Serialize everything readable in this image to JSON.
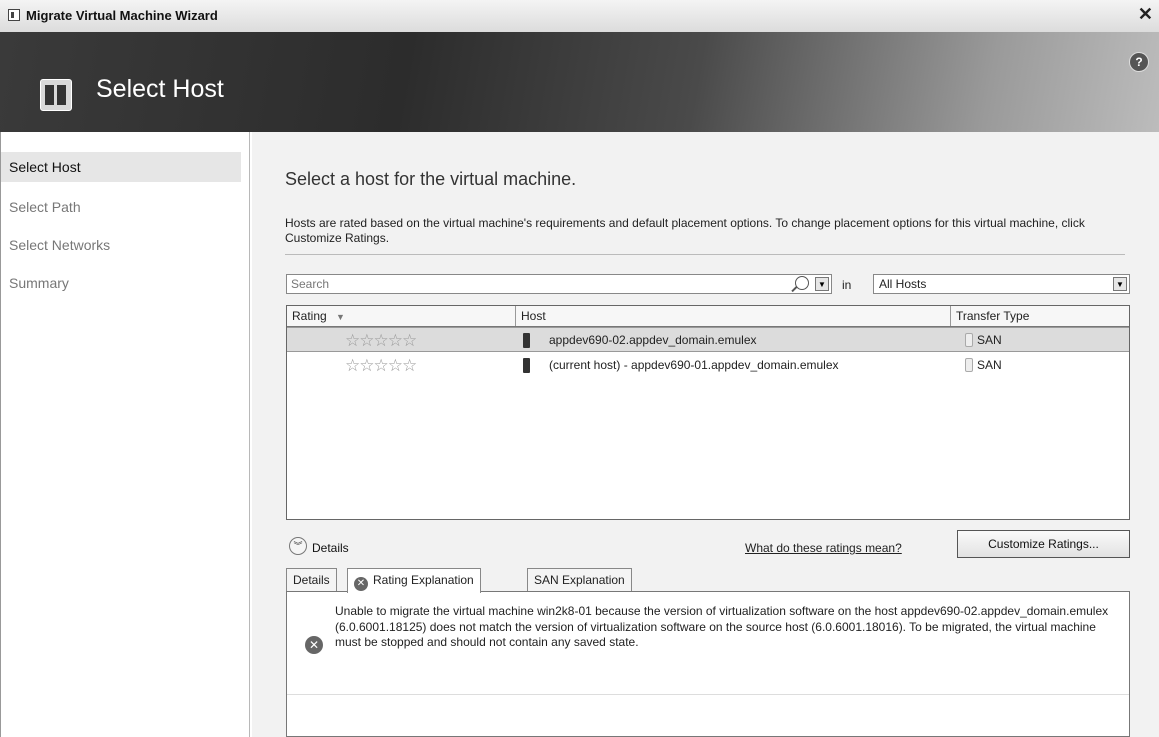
{
  "window": {
    "title": "Migrate Virtual Machine Wizard",
    "close_glyph": "✕"
  },
  "banner": {
    "title": "Select Host",
    "help_glyph": "?"
  },
  "nav": {
    "items": [
      "Select Host",
      "Select Path",
      "Select Networks",
      "Summary"
    ],
    "active": 0
  },
  "main": {
    "heading": "Select a host for the virtual machine.",
    "description": "Hosts are rated based on the virtual machine's requirements and default placement options. To change placement options for this virtual machine, click Customize Ratings.",
    "search": {
      "placeholder": "Search",
      "in_label": "in",
      "scope": "All Hosts"
    },
    "grid": {
      "columns": [
        "Rating",
        "Host",
        "Transfer Type"
      ],
      "rows": [
        {
          "rating": "☆☆☆☆☆",
          "host": "appdev690-02.appdev_domain.emulex",
          "transfer": "SAN",
          "selected": true
        },
        {
          "rating": "☆☆☆☆☆",
          "host": "(current host) - appdev690-01.appdev_domain.emulex",
          "transfer": "SAN",
          "selected": false
        }
      ]
    },
    "details": {
      "toggle_label": "Details",
      "ratings_link": "What do these ratings mean?",
      "customize_button": "Customize Ratings...",
      "tabs": [
        "Details",
        "Rating Explanation",
        "SAN Explanation"
      ],
      "active_tab": 1,
      "message": "Unable to migrate the virtual machine win2k8-01 because the version of virtualization software on the host appdev690-02.appdev_domain.emulex (6.0.6001.18125) does not match the version of virtualization software on the source host (6.0.6001.18016). To be migrated, the virtual machine must be stopped and should not contain any saved state."
    }
  },
  "icons": {
    "app": "server-icon",
    "header": "select-host-icon",
    "help": "help-icon",
    "search": "search-icon",
    "error": "error-icon",
    "host": "host-server-icon",
    "transfer": "disk-icon"
  }
}
